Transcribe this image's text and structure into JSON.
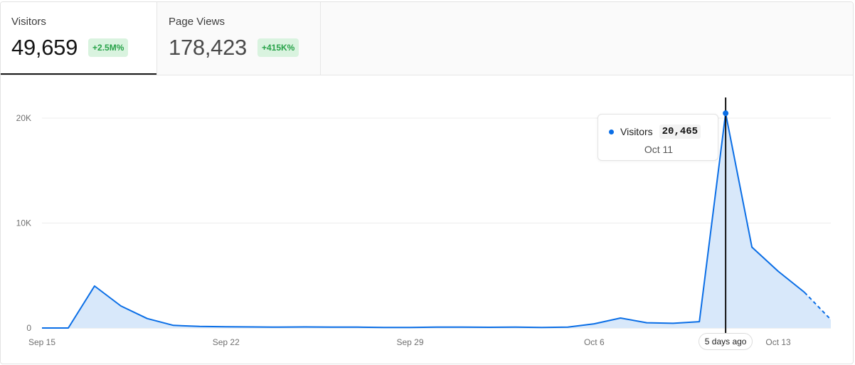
{
  "tabs": [
    {
      "label": "Visitors",
      "value": "49,659",
      "change": "+2.5M%"
    },
    {
      "label": "Page Views",
      "value": "178,423",
      "change": "+415K%"
    }
  ],
  "tooltip": {
    "series": "Visitors",
    "value": "20,465",
    "date": "Oct 11"
  },
  "now_label": "5 days ago",
  "colors": {
    "line": "#0a6ee6",
    "area": "#d8e8fa",
    "badge_bg": "#d9f3df",
    "badge_text": "#27a248"
  },
  "chart_data": {
    "type": "area",
    "title": "",
    "xlabel": "",
    "ylabel": "",
    "ylim": [
      0,
      20000
    ],
    "yticks": [
      0,
      10000,
      20000
    ],
    "ytick_labels": [
      "0",
      "10K",
      "20K"
    ],
    "x_tick_labels": [
      "Sep 15",
      "Sep 22",
      "Sep 29",
      "Oct 6",
      "Oct 13"
    ],
    "x_tick_indices": [
      0,
      7,
      14,
      21,
      28
    ],
    "highlight_index": 26,
    "dashed_from_index": 29,
    "grid": true,
    "series": [
      {
        "name": "Visitors",
        "dates": [
          "Sep 15",
          "Sep 16",
          "Sep 17",
          "Sep 18",
          "Sep 19",
          "Sep 20",
          "Sep 21",
          "Sep 22",
          "Sep 23",
          "Sep 24",
          "Sep 25",
          "Sep 26",
          "Sep 27",
          "Sep 28",
          "Sep 29",
          "Sep 30",
          "Oct 1",
          "Oct 2",
          "Oct 3",
          "Oct 4",
          "Oct 5",
          "Oct 6",
          "Oct 7",
          "Oct 8",
          "Oct 9",
          "Oct 10",
          "Oct 11",
          "Oct 12",
          "Oct 13",
          "Oct 14",
          "Oct 15"
        ],
        "values": [
          0,
          0,
          4000,
          2100,
          900,
          250,
          150,
          120,
          100,
          80,
          100,
          80,
          80,
          50,
          50,
          80,
          80,
          70,
          80,
          50,
          80,
          400,
          950,
          500,
          450,
          600,
          20465,
          7700,
          5400,
          3400,
          800
        ]
      }
    ]
  }
}
